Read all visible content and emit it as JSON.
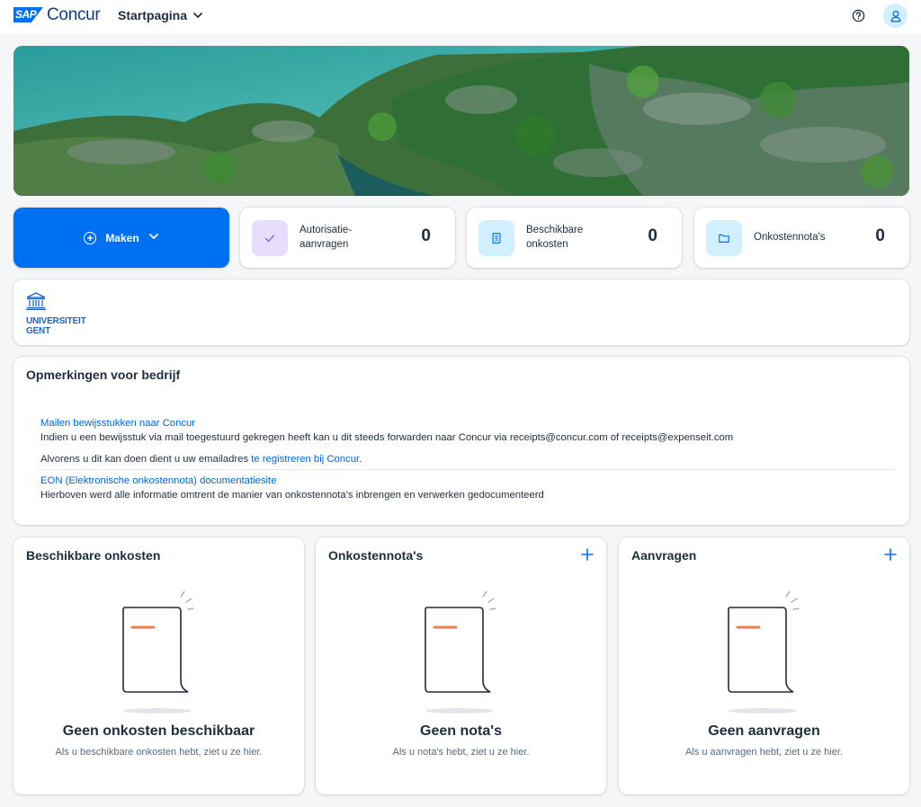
{
  "header": {
    "logo_mark": "SAP",
    "logo_text": "Concur",
    "nav_home": "Startpagina"
  },
  "tiles": {
    "make_label": "Maken",
    "stats": [
      {
        "label_line1": "Autorisatie-",
        "label_line2": "aanvragen",
        "value": "0",
        "icon": "check-icon",
        "icon_bg": "#e8dcff",
        "icon_color": "#7858ff"
      },
      {
        "label_line1": "Beschikbare",
        "label_line2": "onkosten",
        "value": "0",
        "icon": "receipt-icon",
        "icon_bg": "#d1efff",
        "icon_color": "#0070f2"
      },
      {
        "label_line1": "Onkostennota's",
        "label_line2": "",
        "value": "0",
        "icon": "folder-icon",
        "icon_bg": "#d1efff",
        "icon_color": "#0070f2"
      }
    ]
  },
  "company": {
    "logo_line1": "UNIVERSITEIT",
    "logo_line2": "GENT"
  },
  "remarks": {
    "title": "Opmerkingen voor bedrijf",
    "link1": "Mailen bewijsstukken naar Concur",
    "text1": "Indien u een bewijsstuk via mail toegestuurd gekregen heeft kan u dit steeds forwarden naar Concur via receipts@concur.com of receipts@expenseit.com",
    "text2_prefix": "Alvorens u dit kan doen dient u uw emailadres ",
    "text2_link": "te registreren bij Concur",
    "text2_suffix": ".",
    "link2": "EON (Elektronische onkostennota) documentatiesite",
    "text3": "Hierboven werd alle informatie omtrent de manier van onkostennota's inbrengen en verwerken gedocumenteerd"
  },
  "panels": [
    {
      "title": "Beschikbare onkosten",
      "empty_title": "Geen onkosten beschikbaar",
      "empty_sub": "Als u beschikbare onkosten hebt, ziet u ze hier."
    },
    {
      "title": "Onkostennota's",
      "empty_title": "Geen nota's",
      "empty_sub": "Als u nota's hebt, ziet u ze hier."
    },
    {
      "title": "Aanvragen",
      "empty_title": "Geen aanvragen",
      "empty_sub": "Als u aanvragen hebt, ziet u ze hier."
    }
  ],
  "colors": {
    "brand": "#0070f2",
    "link": "#0064d9",
    "accent_orange": "#ef7f52"
  }
}
